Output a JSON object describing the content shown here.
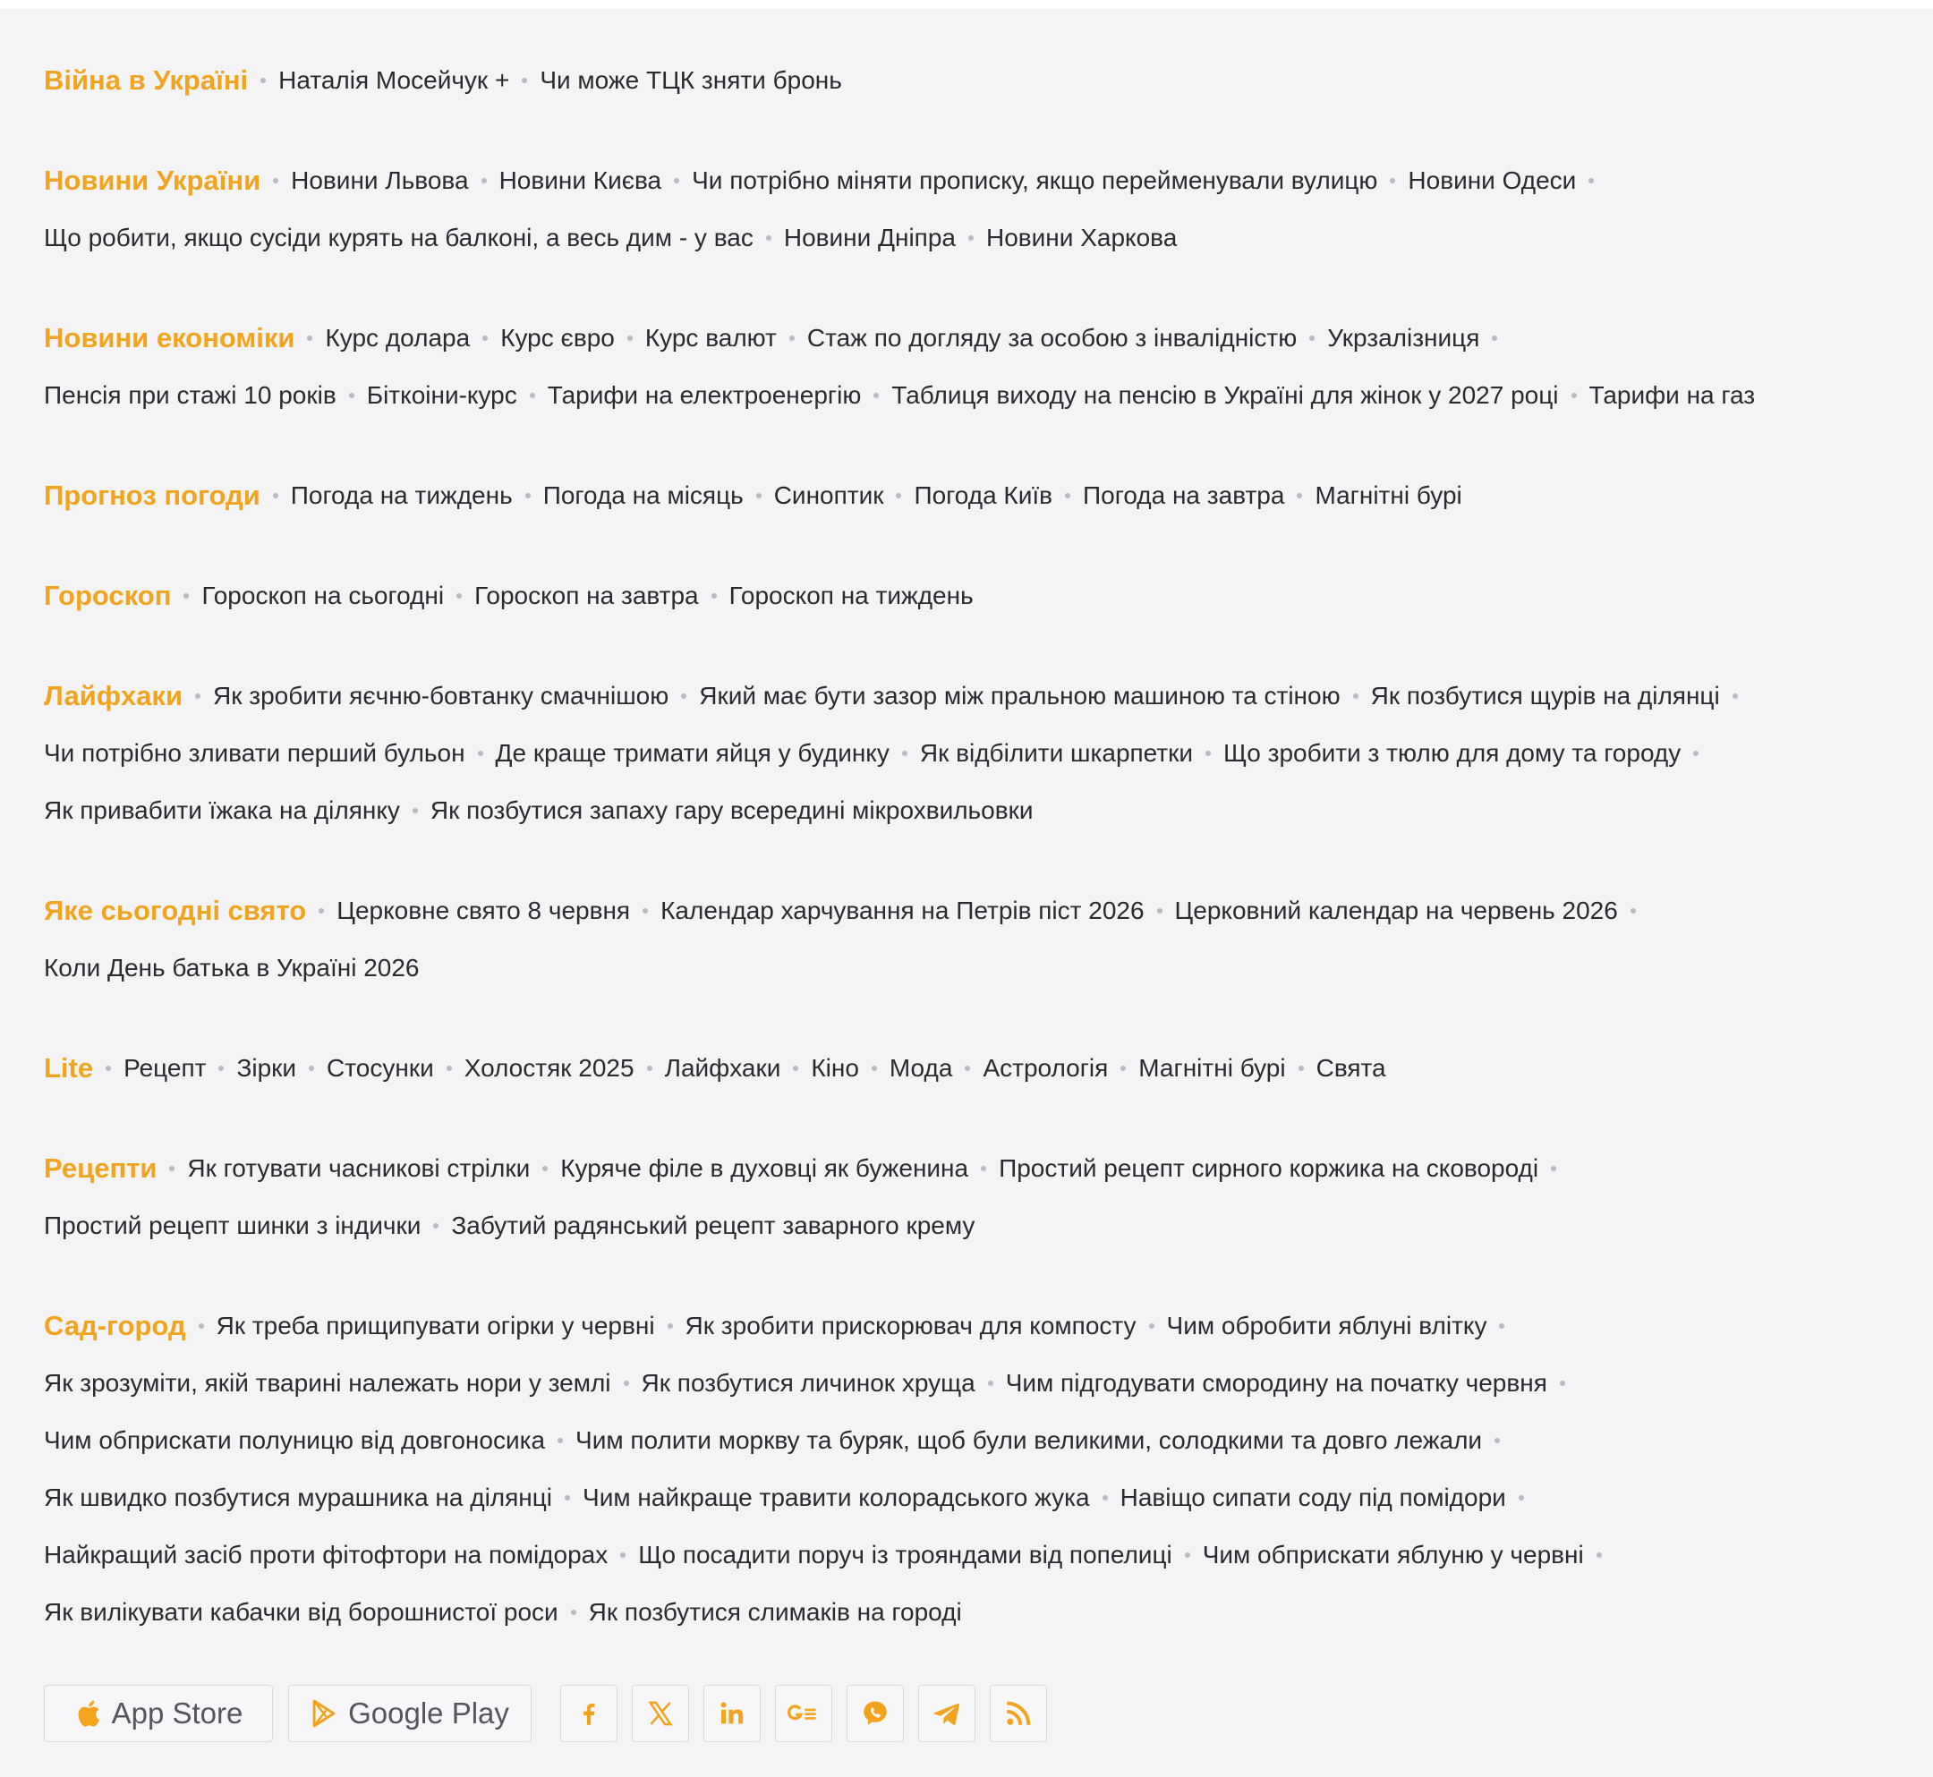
{
  "colors": {
    "accent": "#f2a41f",
    "link": "#2b2b2f",
    "background": "#f4f4f6",
    "separator": "#b9bbc1"
  },
  "sections": [
    {
      "title": "Війна в Україні",
      "lines": [
        [
          "Наталія Мосейчук +",
          "Чи може ТЦК зняти бронь"
        ]
      ]
    },
    {
      "title": "Новини України",
      "lines": [
        [
          "Новини Львова",
          "Новини Києва",
          "Чи потрібно міняти прописку, якщо перейменували вулицю",
          "Новини Одеси"
        ],
        [
          "Що робити, якщо сусіди курять на балконі, а весь дим - у вас",
          "Новини Дніпра",
          "Новини Харкова"
        ]
      ]
    },
    {
      "title": "Новини економіки",
      "lines": [
        [
          "Курс долара",
          "Курс євро",
          "Курс валют",
          "Стаж по догляду за особою з інвалідністю",
          "Укрзалізниця"
        ],
        [
          "Пенсія при стажі 10 років",
          "Біткоіни-курс",
          "Тарифи на електроенергію",
          "Таблиця виходу на пенсію в Україні для жінок у 2027 році",
          "Тарифи на газ"
        ]
      ]
    },
    {
      "title": "Прогноз погоди",
      "lines": [
        [
          "Погода на тиждень",
          "Погода на місяць",
          "Синоптик",
          "Погода Київ",
          "Погода на завтра",
          "Магнітні бурі"
        ]
      ]
    },
    {
      "title": "Гороскоп",
      "lines": [
        [
          "Гороскоп на сьогодні",
          "Гороскоп на завтра",
          "Гороскоп на тиждень"
        ]
      ]
    },
    {
      "title": "Лайфхаки",
      "lines": [
        [
          "Як зробити яєчню-бовтанку смачнішою",
          "Який має бути зазор між пральною машиною та стіною",
          "Як позбутися щурів на ділянці"
        ],
        [
          "Чи потрібно зливати перший бульон",
          "Де краще тримати яйця у будинку",
          "Як відбілити шкарпетки",
          "Що зробити з тюлю для дому та городу"
        ],
        [
          "Як привабити їжака на ділянку",
          "Як позбутися запаху гару всередині мікрохвильовки"
        ]
      ]
    },
    {
      "title": "Яке сьогодні свято",
      "lines": [
        [
          "Церковне свято 8 червня",
          "Календар харчування на Петрів піст 2026",
          "Церковний календар на червень 2026"
        ],
        [
          "Коли День батька в Україні 2026"
        ]
      ]
    },
    {
      "title": "Lite",
      "lines": [
        [
          "Рецепт",
          "Зірки",
          "Стосунки",
          "Холостяк 2025",
          "Лайфхаки",
          "Кіно",
          "Мода",
          "Астрологія",
          "Магнітні бурі",
          "Свята"
        ]
      ]
    },
    {
      "title": "Рецепти",
      "lines": [
        [
          "Як готувати часникові стрілки",
          "Куряче філе в духовці як буженина",
          "Простий рецепт сирного коржика на сковороді"
        ],
        [
          "Простий рецепт шинки з індички",
          "Забутий радянський рецепт заварного крему"
        ]
      ]
    },
    {
      "title": "Сад-город",
      "lines": [
        [
          "Як треба прищипувати огірки у червні",
          "Як зробити прискорювач для компосту",
          "Чим обробити яблуні влітку"
        ],
        [
          "Як зрозуміти, якій тварині належать нори у землі",
          "Як позбутися личинок хруща",
          "Чим підгодувати смородину на початку червня"
        ],
        [
          "Чим обприскати полуницю від довгоносика",
          "Чим полити моркву та буряк, щоб були великими, солодкими та довго лежали"
        ],
        [
          "Як швидко позбутися мурашника на ділянці",
          "Чим найкраще травити колорадського жука",
          "Навіщо сипати соду під помідори"
        ],
        [
          "Найкращий засіб проти фітофтори на помідорах",
          "Що посадити поруч із трояндами від попелиці",
          "Чим обприскати яблуню у червні"
        ],
        [
          "Як вилікувати кабачки від борошнистої роси",
          "Як позбутися слимаків на городі"
        ]
      ]
    }
  ],
  "footer": {
    "stores": [
      {
        "label": "App Store",
        "icon": "apple-icon"
      },
      {
        "label": "Google Play",
        "icon": "google-play-icon"
      }
    ],
    "social": [
      "facebook-icon",
      "x-icon",
      "linkedin-icon",
      "google-news-icon",
      "viber-icon",
      "telegram-icon",
      "rss-icon"
    ]
  }
}
